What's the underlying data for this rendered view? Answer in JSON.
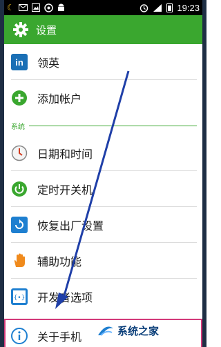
{
  "status_bar": {
    "time": "19:23",
    "icons": [
      "moon-icon",
      "mail-icon",
      "image-icon",
      "browser-icon",
      "android-icon",
      "alarm-icon",
      "signal-icon",
      "battery-icon"
    ]
  },
  "action_bar": {
    "title": "设置",
    "icon": "gear-icon"
  },
  "items": [
    {
      "label": "领英",
      "icon": "linkedin-icon"
    },
    {
      "label": "添加帐户",
      "icon": "add-circle-icon"
    }
  ],
  "section": {
    "label": "系统"
  },
  "system_items": [
    {
      "label": "日期和时间",
      "icon": "clock-icon"
    },
    {
      "label": "定时开关机",
      "icon": "power-icon"
    },
    {
      "label": "恢复出厂设置",
      "icon": "reset-icon"
    },
    {
      "label": "辅助功能",
      "icon": "hand-icon"
    },
    {
      "label": "开发者选项",
      "icon": "developer-icon"
    },
    {
      "label": "关于手机",
      "icon": "info-icon"
    }
  ],
  "watermark": {
    "text": "系统之家"
  },
  "colors": {
    "accent": "#3aa72f",
    "highlight_border": "#d33a7a",
    "arrow": "#1f3fa8"
  }
}
